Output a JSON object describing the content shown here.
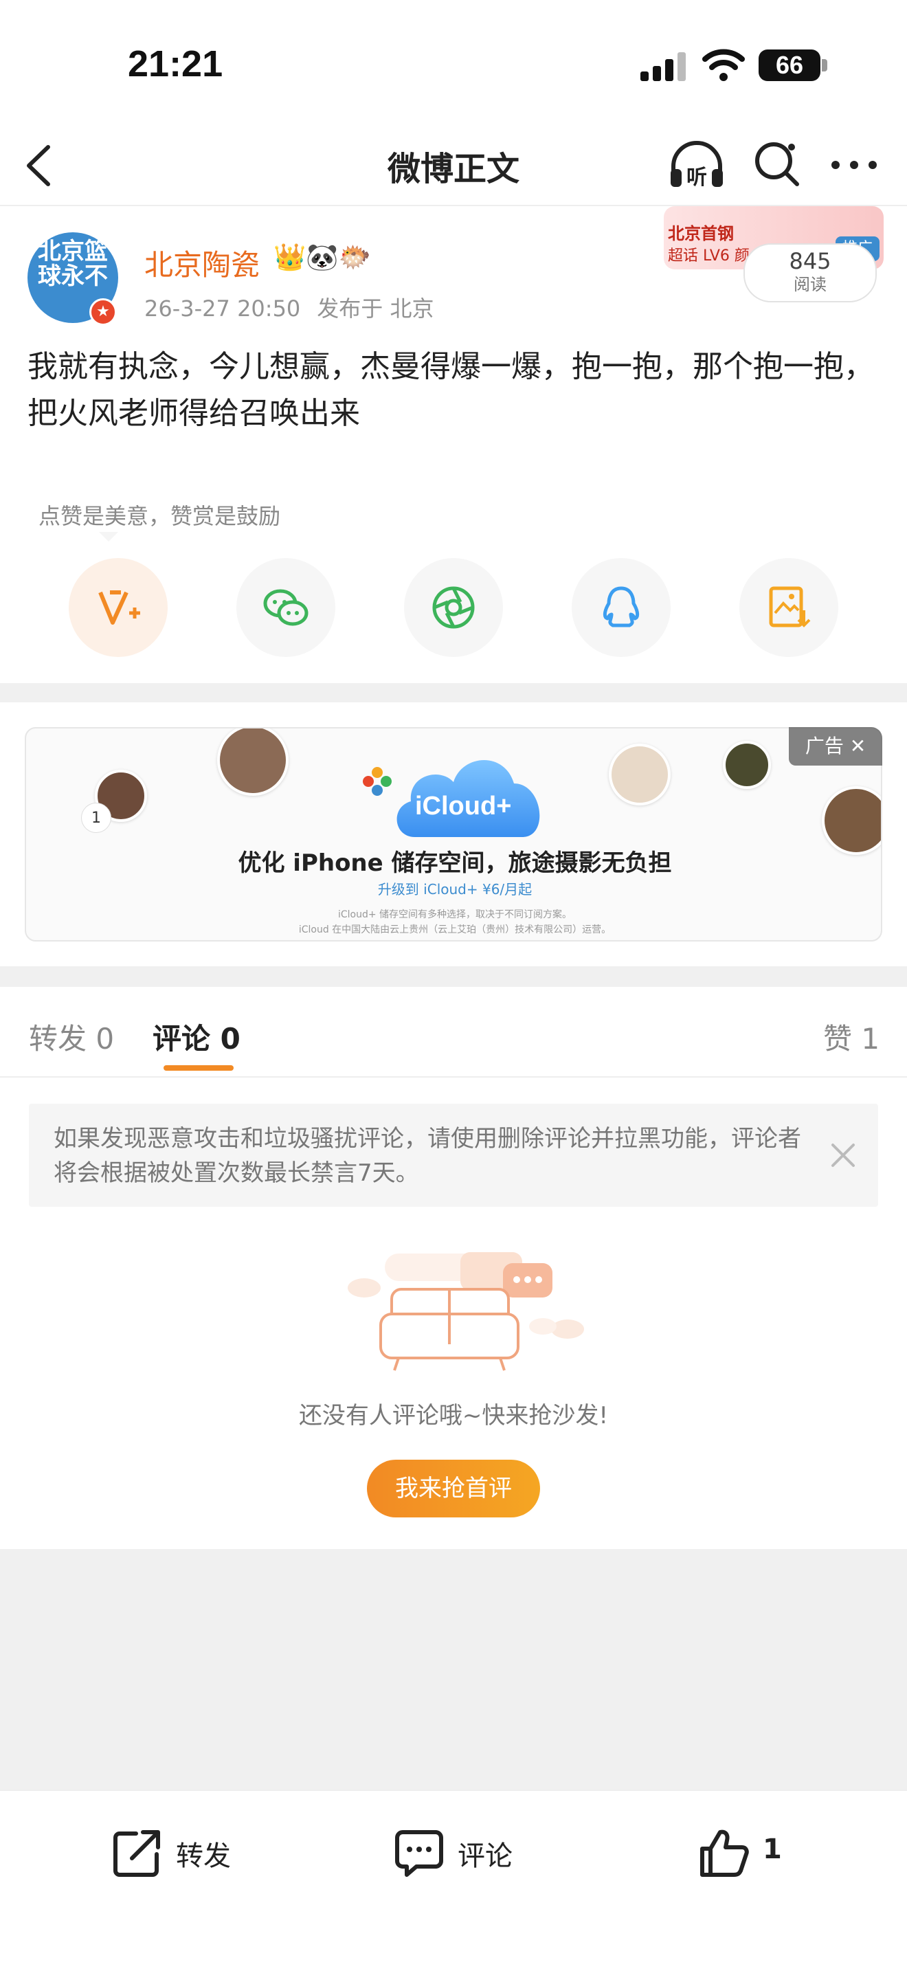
{
  "status_bar": {
    "time": "21:21",
    "battery": "66"
  },
  "nav": {
    "title": "微博正文",
    "listen_label": "听"
  },
  "author": {
    "name": "北京陶瓷",
    "avatar_text": "北京篮球永不",
    "badges": "👑🐼🐡",
    "time": "26-3-27 20:50",
    "location": "发布于 北京"
  },
  "promo": {
    "title": "北京首钢",
    "subtitle": "超话 LV6 颜",
    "tag": "推广"
  },
  "reads": {
    "count": "845",
    "label": "阅读"
  },
  "post": {
    "text": "我就有执念，今儿想赢，杰曼得爆一爆，抱一抱，那个抱一抱，把火风老师得给召唤出来"
  },
  "reward_tip": "点赞是美意，赞赏是鼓励",
  "share_icons": [
    "vplus-icon",
    "wechat-icon",
    "moments-icon",
    "qq-icon",
    "save-image-icon"
  ],
  "ad": {
    "label": "广告 ✕",
    "brand": "iCloud+",
    "headline": "优化 iPhone 储存空间，旅途摄影无负担",
    "subline": "升级到 iCloud+ ¥6/月起",
    "fine_print_1": "iCloud+ 储存空间有多种选择，取决于不同订阅方案。",
    "fine_print_2": "iCloud 在中国大陆由云上贵州（云上艾珀（贵州）技术有限公司）运营。",
    "counter": "1"
  },
  "tabs": {
    "repost": "转发 0",
    "comment": "评论 0",
    "like": "赞 1"
  },
  "notice": {
    "text": "如果发现恶意攻击和垃圾骚扰评论，请使用删除评论并拉黑功能，评论者将会根据被处置次数最长禁言7天。"
  },
  "empty": {
    "text": "还没有人评论哦~快来抢沙发!",
    "button": "我来抢首评"
  },
  "footer": {
    "repost": "转发",
    "comment": "评论",
    "like": "1"
  },
  "colors": {
    "accent": "#f28a24",
    "name": "#e86b1f",
    "link": "#3c8ccf"
  }
}
